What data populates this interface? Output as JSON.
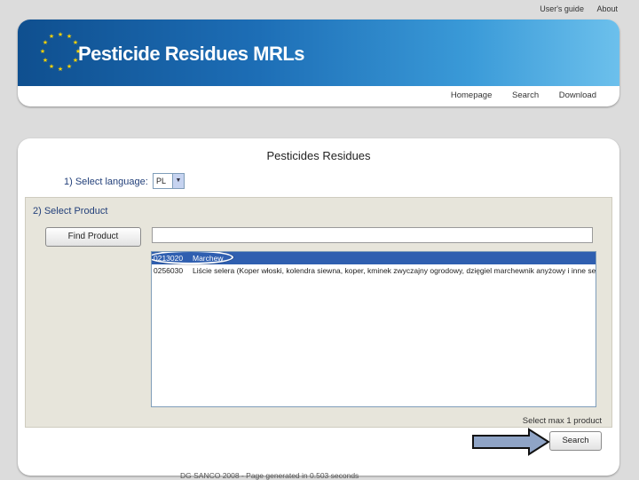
{
  "top_links": [
    "User's guide",
    "About"
  ],
  "header": {
    "title": "Pesticide Residues MRLs",
    "nav": [
      "Homepage",
      "Search",
      "Download"
    ]
  },
  "main": {
    "title": "Pesticides Residues",
    "language": {
      "label": "1) Select language:",
      "value": "PL"
    },
    "product": {
      "section_label": "2) Select Product",
      "find_button": "Find Product",
      "search_value": "",
      "list": [
        {
          "code": "0213020",
          "name": "Marchew",
          "selected": true
        },
        {
          "code": "0256030",
          "name": "Liście selera (Koper włoski, kolendra siewna, koper, kminek zwyczajny ogrodowy, dzięgiel marchewnik anyżowy i inne selerowate (liście))",
          "selected": false
        }
      ],
      "max_note": "Select max 1 product",
      "search_button": "Search"
    }
  },
  "footer": "DG SANCO 2008 - Page generated in 0.503 seconds",
  "colors": {
    "banner_start": "#0f4f8f",
    "banner_end": "#6cc0ec",
    "selection": "#2f5fb0",
    "label": "#23407a"
  }
}
